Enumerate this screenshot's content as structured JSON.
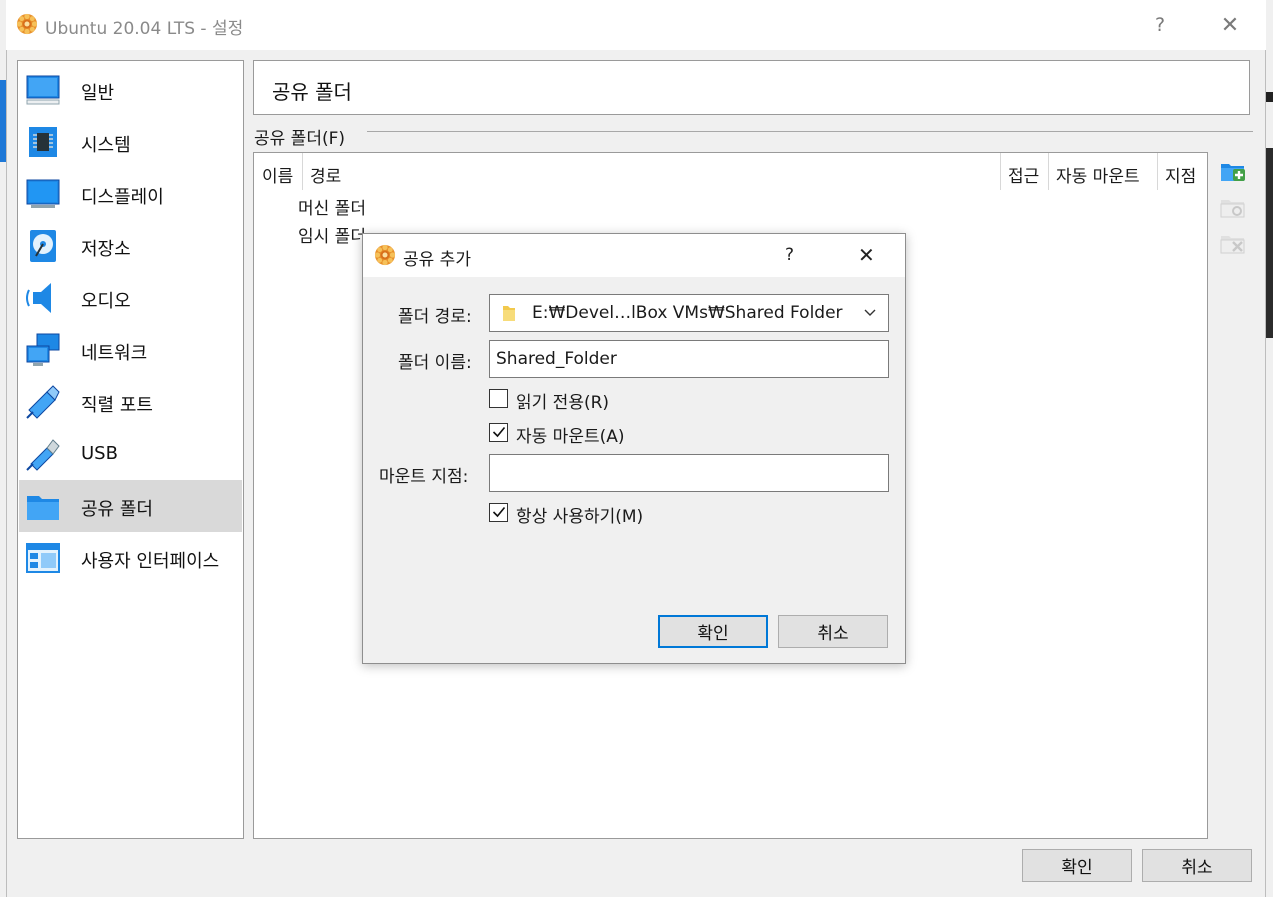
{
  "window": {
    "title": "Ubuntu 20.04 LTS - 설정",
    "help_glyph": "?",
    "close_glyph": "✕"
  },
  "sidebar": {
    "items": [
      {
        "label": "일반",
        "icon": "general-monitor-icon"
      },
      {
        "label": "시스템",
        "icon": "system-chip-icon"
      },
      {
        "label": "디스플레이",
        "icon": "display-monitor-icon"
      },
      {
        "label": "저장소",
        "icon": "storage-disk-icon"
      },
      {
        "label": "오디오",
        "icon": "audio-speaker-icon"
      },
      {
        "label": "네트워크",
        "icon": "network-icon"
      },
      {
        "label": "직렬 포트",
        "icon": "serial-port-icon"
      },
      {
        "label": "USB",
        "icon": "usb-icon"
      },
      {
        "label": "공유 폴더",
        "icon": "shared-folder-icon",
        "selected": true
      },
      {
        "label": "사용자 인터페이스",
        "icon": "user-interface-icon"
      }
    ]
  },
  "page": {
    "title": "공유 폴더",
    "group_label": "공유 폴더(F)"
  },
  "table": {
    "columns": [
      "이름",
      "경로",
      "접근",
      "자동 마운트",
      "지점"
    ],
    "rows": [
      "머신 폴더",
      "임시 폴더"
    ]
  },
  "tools": [
    "add-shared-folder-icon",
    "edit-shared-folder-icon",
    "remove-shared-folder-icon"
  ],
  "buttons": {
    "ok": "확인",
    "cancel": "취소"
  },
  "dialog": {
    "title": "공유 추가",
    "help_glyph": "?",
    "close_glyph": "✕",
    "folder_path_label": "폴더 경로:",
    "folder_path_value": "E:₩Devel…lBox VMs₩Shared Folder",
    "folder_name_label": "폴더 이름:",
    "folder_name_value": "Shared_Folder",
    "read_only_label": "읽기 전용(R)",
    "read_only_checked": false,
    "auto_mount_label": "자동 마운트(A)",
    "auto_mount_checked": true,
    "mount_point_label": "마운트 지점:",
    "mount_point_value": "",
    "permanent_label": "항상 사용하기(M)",
    "permanent_checked": true,
    "ok": "확인",
    "cancel": "취소"
  },
  "colors": {
    "accent": "#0078d7",
    "selection": "#d9d9d9",
    "icon_blue": "#1e88e5",
    "vbox_orange": "#f0a030"
  }
}
